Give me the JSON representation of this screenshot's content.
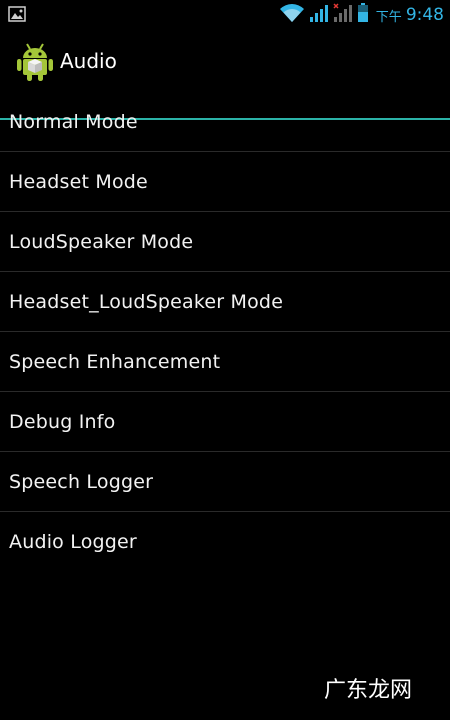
{
  "status_bar": {
    "notification_icon": "image-icon",
    "wifi_icon": "wifi-icon",
    "signal_icon": "cell-signal-icon",
    "no_signal_icon": "no-signal-icon",
    "battery_icon": "battery-icon",
    "time_prefix": "下午",
    "time": "9:48",
    "accent_color": "#33b5e5"
  },
  "action_bar": {
    "app_icon": "android-icon",
    "title": "Audio",
    "divider_color": "#2bb3a8"
  },
  "menu": {
    "items": [
      {
        "label": "Normal Mode"
      },
      {
        "label": "Headset Mode"
      },
      {
        "label": "LoudSpeaker Mode"
      },
      {
        "label": "Headset_LoudSpeaker Mode"
      },
      {
        "label": "Speech Enhancement"
      },
      {
        "label": "Debug Info"
      },
      {
        "label": "Speech Logger"
      },
      {
        "label": "Audio Logger"
      }
    ]
  },
  "watermark": {
    "text": "广东龙网"
  }
}
